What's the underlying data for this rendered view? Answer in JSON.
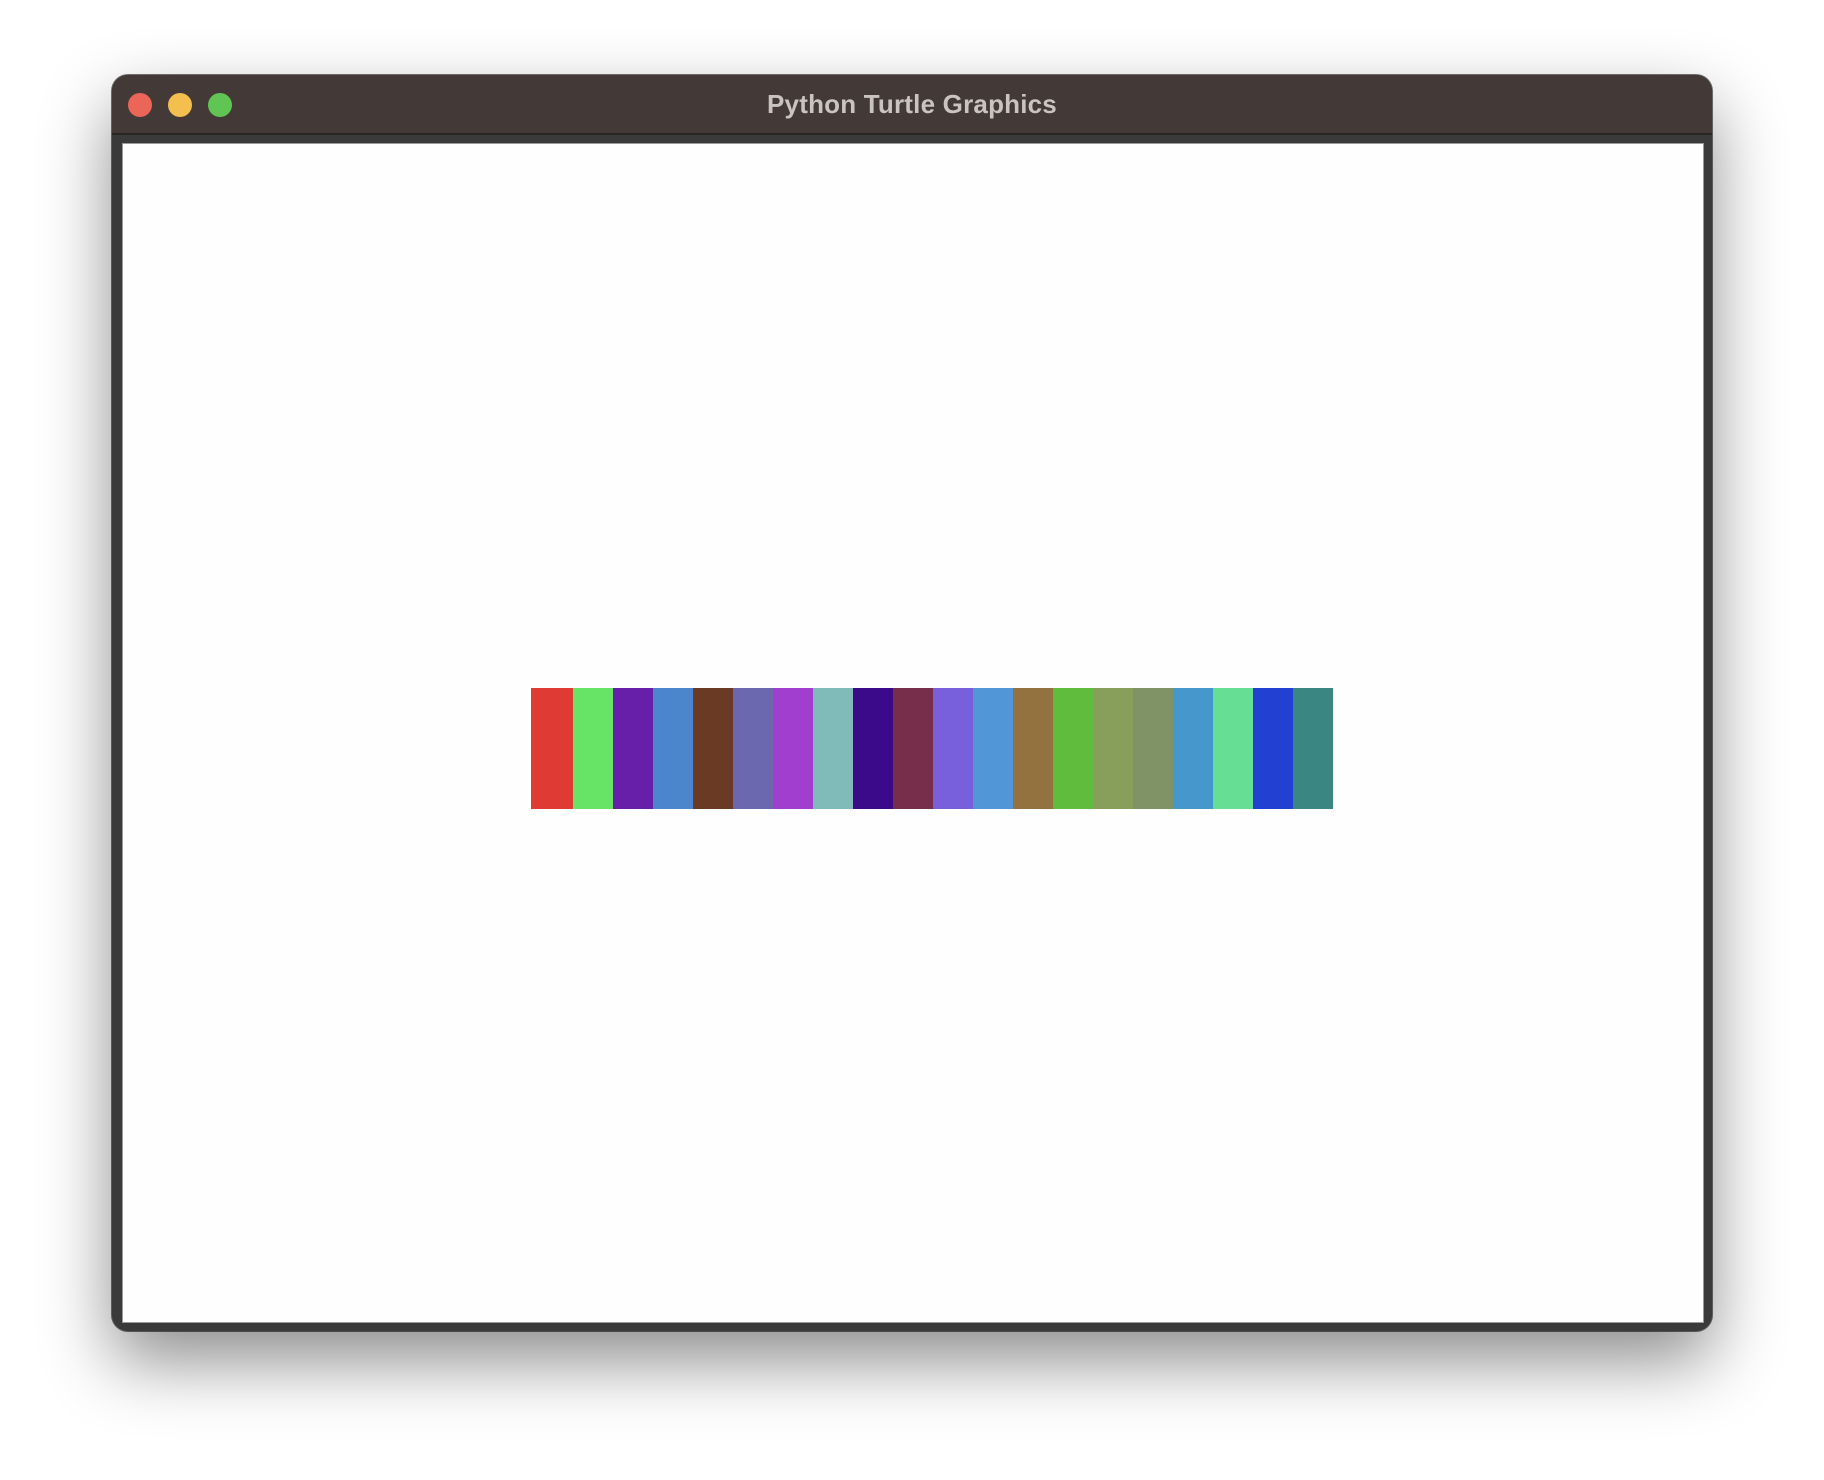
{
  "window": {
    "title": "Python Turtle Graphics",
    "controls": {
      "close_color": "#ec6559",
      "minimize_color": "#f4bf4f",
      "zoom_color": "#61c554"
    }
  },
  "canvas": {
    "background": "#fefefe",
    "swatches": [
      "#e03a35",
      "#67e365",
      "#671fa9",
      "#4b85cb",
      "#6b3a25",
      "#6c68b0",
      "#a23ecf",
      "#80bab9",
      "#3b0a8b",
      "#762e4b",
      "#7860dc",
      "#5196d6",
      "#94723f",
      "#60bc3c",
      "#889f5c",
      "#7f9366",
      "#4697cb",
      "#66df94",
      "#2241d2",
      "#398683"
    ]
  }
}
